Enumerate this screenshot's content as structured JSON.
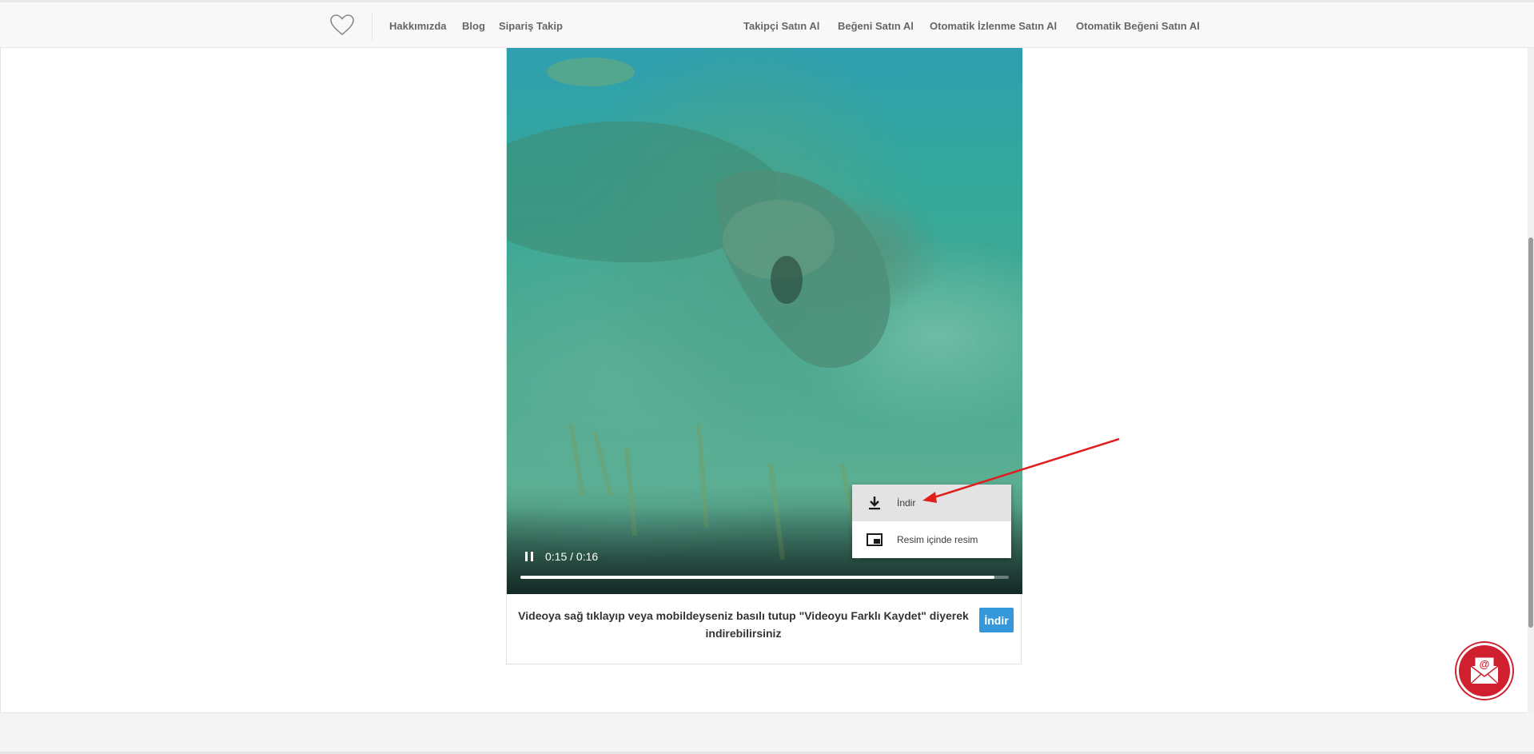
{
  "nav": {
    "logo_icon": "heart-outline-icon",
    "left_links": [
      "Hakkımızda",
      "Blog",
      "Sipariş Takip"
    ],
    "right_links": [
      "Takipçi Satın Al",
      "Beğeni Satın Al",
      "Otomatik İzlenme Satın Al",
      "Otomatik Beğeni Satın Al"
    ]
  },
  "player": {
    "time": "0:15 / 0:16",
    "progress": 0.97,
    "state_icon": "pause-icon"
  },
  "context_menu": {
    "items": [
      {
        "label": "İndir",
        "icon": "download-icon",
        "highlighted": true
      },
      {
        "label": "Resim içinde resim",
        "icon": "picture-in-picture-icon",
        "highlighted": false
      }
    ]
  },
  "caption": {
    "text": "Videoya sağ tıklayıp veya mobildeyseniz basılı tutup \"Videoyu Farklı Kaydet\" diyerek indirebilirsiniz",
    "button_label": "İndir"
  },
  "colors": {
    "accent_button": "#3498db",
    "mail_button": "#d02030",
    "annotation_arrow": "#e01e1e"
  },
  "floating": {
    "icon": "mail-at-icon"
  }
}
